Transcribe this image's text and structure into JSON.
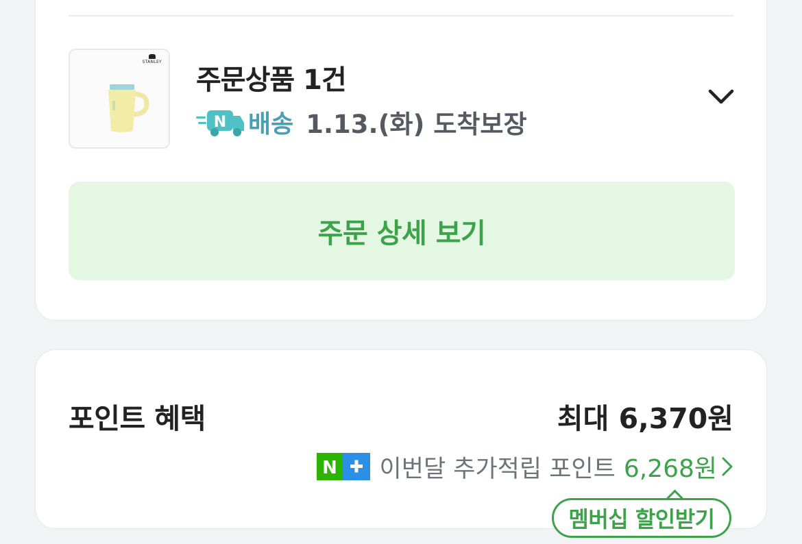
{
  "order": {
    "title": "주문상품 1건",
    "delivery_badge": "배송",
    "delivery_date": "1.13.(화) 도착보장",
    "detail_button": "주문 상세 보기",
    "brand_logo_text": "STANLEY"
  },
  "points": {
    "title": "포인트 혜택",
    "total": "최대 6,370원",
    "bonus_label": "이번달 추가적립 포인트",
    "bonus_value": "6,268원",
    "membership_button": "멤버십 할인받기"
  },
  "colors": {
    "accent_green": "#3da34a",
    "button_bg": "#e3f7e3",
    "delivery_teal": "#4a9fb5",
    "page_bg": "#f2f3f5"
  },
  "icons": {
    "truck": "n-delivery-truck-icon",
    "chevron": "chevron-down-icon",
    "nplus": "naver-plus-icon",
    "arrow": "chevron-right-icon"
  }
}
